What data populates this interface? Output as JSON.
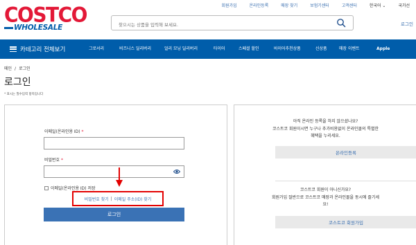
{
  "utility_nav": [
    "회원가입",
    "온라인등록",
    "매장 찾기",
    "보험기센터",
    "고객센터",
    "한국어",
    "국가선"
  ],
  "logo": {
    "costco": "COSTCO",
    "wholesale": "WHOLESALE"
  },
  "search": {
    "placeholder": "찾으시는 상품을 입력해 보세요."
  },
  "header_login": "로그인",
  "nav": {
    "categories": "카테고리 전체보기",
    "items": [
      "그로서리",
      "비즈니스 딜리버리",
      "얼리 모닝 딜리버리",
      "타이어",
      "스페셜 할인",
      "바이어추천상품",
      "신상품",
      "매장 이벤트",
      "Apple"
    ]
  },
  "breadcrumb": {
    "home": "메인",
    "sep": "/",
    "current": "로그인"
  },
  "page_title": "로그인",
  "required_note": "* 표시는 필수입력 항목입니다",
  "login_form": {
    "id_label": "이메일(온라인용 ID)",
    "pw_label": "비밀번호",
    "required_mark": "*",
    "remember_label": "이메일(온라인용 ID) 저장",
    "find_pw": "비밀번호 찾기",
    "find_sep": "|",
    "find_email": "이메일 주소(ID) 찾기",
    "login_button": "로그인"
  },
  "right_panel": {
    "online_q": "아직 온라인 등록을 하지 않으셨나요?",
    "online_desc1": "코스트코 회원이시면 누구나 추가비용없이 온라인몰의 특별한",
    "online_desc2": "혜택을 누리세요.",
    "online_button": "온라인등록",
    "member_q": "코스트코 회원이 아니신가요?",
    "member_desc1": "회원가입 절반으로 코스트코 매장과 온라인몰을 동시에 즐기세",
    "member_desc2": "요!",
    "member_button": "코스트코 회원가입"
  },
  "colors": {
    "brand_blue": "#005daa",
    "brand_red": "#e31837",
    "highlight": "#e30000",
    "button_blue": "#3a72b5"
  }
}
